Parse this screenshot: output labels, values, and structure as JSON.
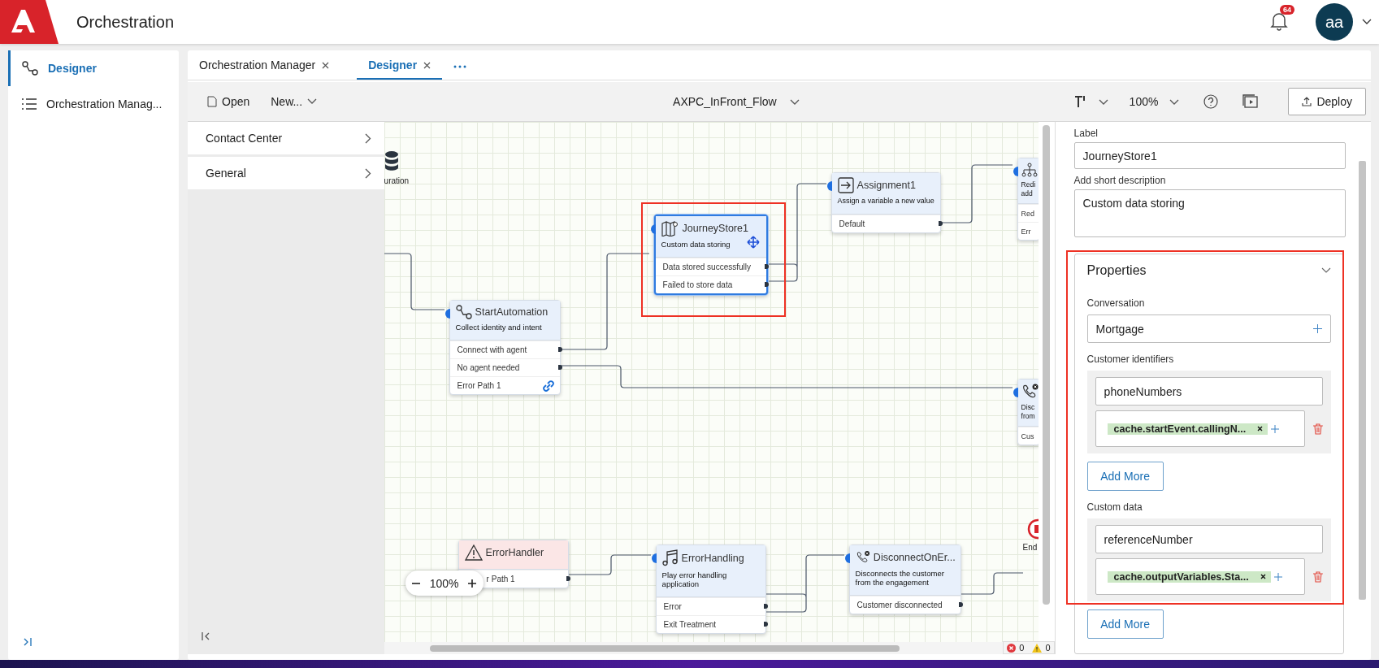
{
  "header": {
    "title": "Orchestration",
    "notifications": "64",
    "avatar": "aa"
  },
  "sidebar": {
    "items": [
      {
        "label": "Designer",
        "selected": true
      },
      {
        "label": "Orchestration Manag...",
        "selected": false
      }
    ]
  },
  "tabs": [
    {
      "label": "Orchestration Manager",
      "selected": false
    },
    {
      "label": "Designer",
      "selected": true
    }
  ],
  "toolbar": {
    "open": "Open",
    "new": "New...",
    "flow_name": "AXPC_InFront_Flow",
    "zoom": "100%",
    "deploy": "Deploy"
  },
  "palette": [
    {
      "label": "Contact Center"
    },
    {
      "label": "General"
    }
  ],
  "canvas": {
    "nodes": [
      {
        "kind": "config",
        "title": "uration"
      },
      {
        "kind": "task",
        "title": "JourneyStore1",
        "description": "Custom data storing",
        "outputs": [
          "Data stored successfully",
          "Failed to store data"
        ],
        "selected": true,
        "highlighted": true
      },
      {
        "kind": "task",
        "title": "StartAutomation",
        "description": "Collect identity and intent",
        "outputs": [
          "Connect with agent",
          "No agent needed",
          "Error Path 1"
        ],
        "selected": false,
        "highlighted": false
      },
      {
        "kind": "task",
        "title": "Assignment1",
        "description": "Assign a variable a new value",
        "outputs": [
          "Default"
        ],
        "selected": false,
        "highlighted": false
      },
      {
        "kind": "partial",
        "description_lines": [
          "Redi",
          "add"
        ],
        "outputs": [
          "Red",
          "Err"
        ],
        "selected": false,
        "highlighted": false
      },
      {
        "kind": "partial",
        "description_lines": [
          "Disc",
          "from"
        ],
        "outputs": [
          "Cus"
        ],
        "selected": false,
        "highlighted": false
      },
      {
        "kind": "error",
        "title": "ErrorHandler",
        "outputs": [
          "r Path 1"
        ],
        "selected": false,
        "highlighted": false
      },
      {
        "kind": "task",
        "title": "ErrorHandling",
        "description": "Play error handling application",
        "outputs": [
          "Error",
          "Exit Treatment"
        ],
        "selected": false,
        "highlighted": false
      },
      {
        "kind": "task",
        "title": "DisconnectOnEr...",
        "description": "Disconnects the customer from the engagement",
        "outputs": [
          "Customer disconnected"
        ],
        "selected": false,
        "highlighted": false
      },
      {
        "kind": "end",
        "title": "End"
      }
    ],
    "zoom_control": {
      "value": "100%"
    },
    "status": {
      "errors": "0",
      "warnings": "0"
    }
  },
  "inspector": {
    "fields": [
      {
        "kind": "input",
        "label": "Label",
        "value": "JourneyStore1"
      },
      {
        "kind": "textarea",
        "label": "Add short description",
        "value": "Custom data storing"
      }
    ],
    "properties": {
      "title": "Properties",
      "expanded": true,
      "highlighted": true,
      "conversation": {
        "label": "Conversation",
        "value": "Mortgage"
      },
      "groups": [
        {
          "label": "Customer identifiers",
          "key": "phoneNumbers",
          "chip": "cache.startEvent.callingN...",
          "button": "Add More"
        },
        {
          "label": "Custom data",
          "key": "referenceNumber",
          "chip": "cache.outputVariables.Sta...",
          "button": "Add More"
        }
      ]
    }
  }
}
